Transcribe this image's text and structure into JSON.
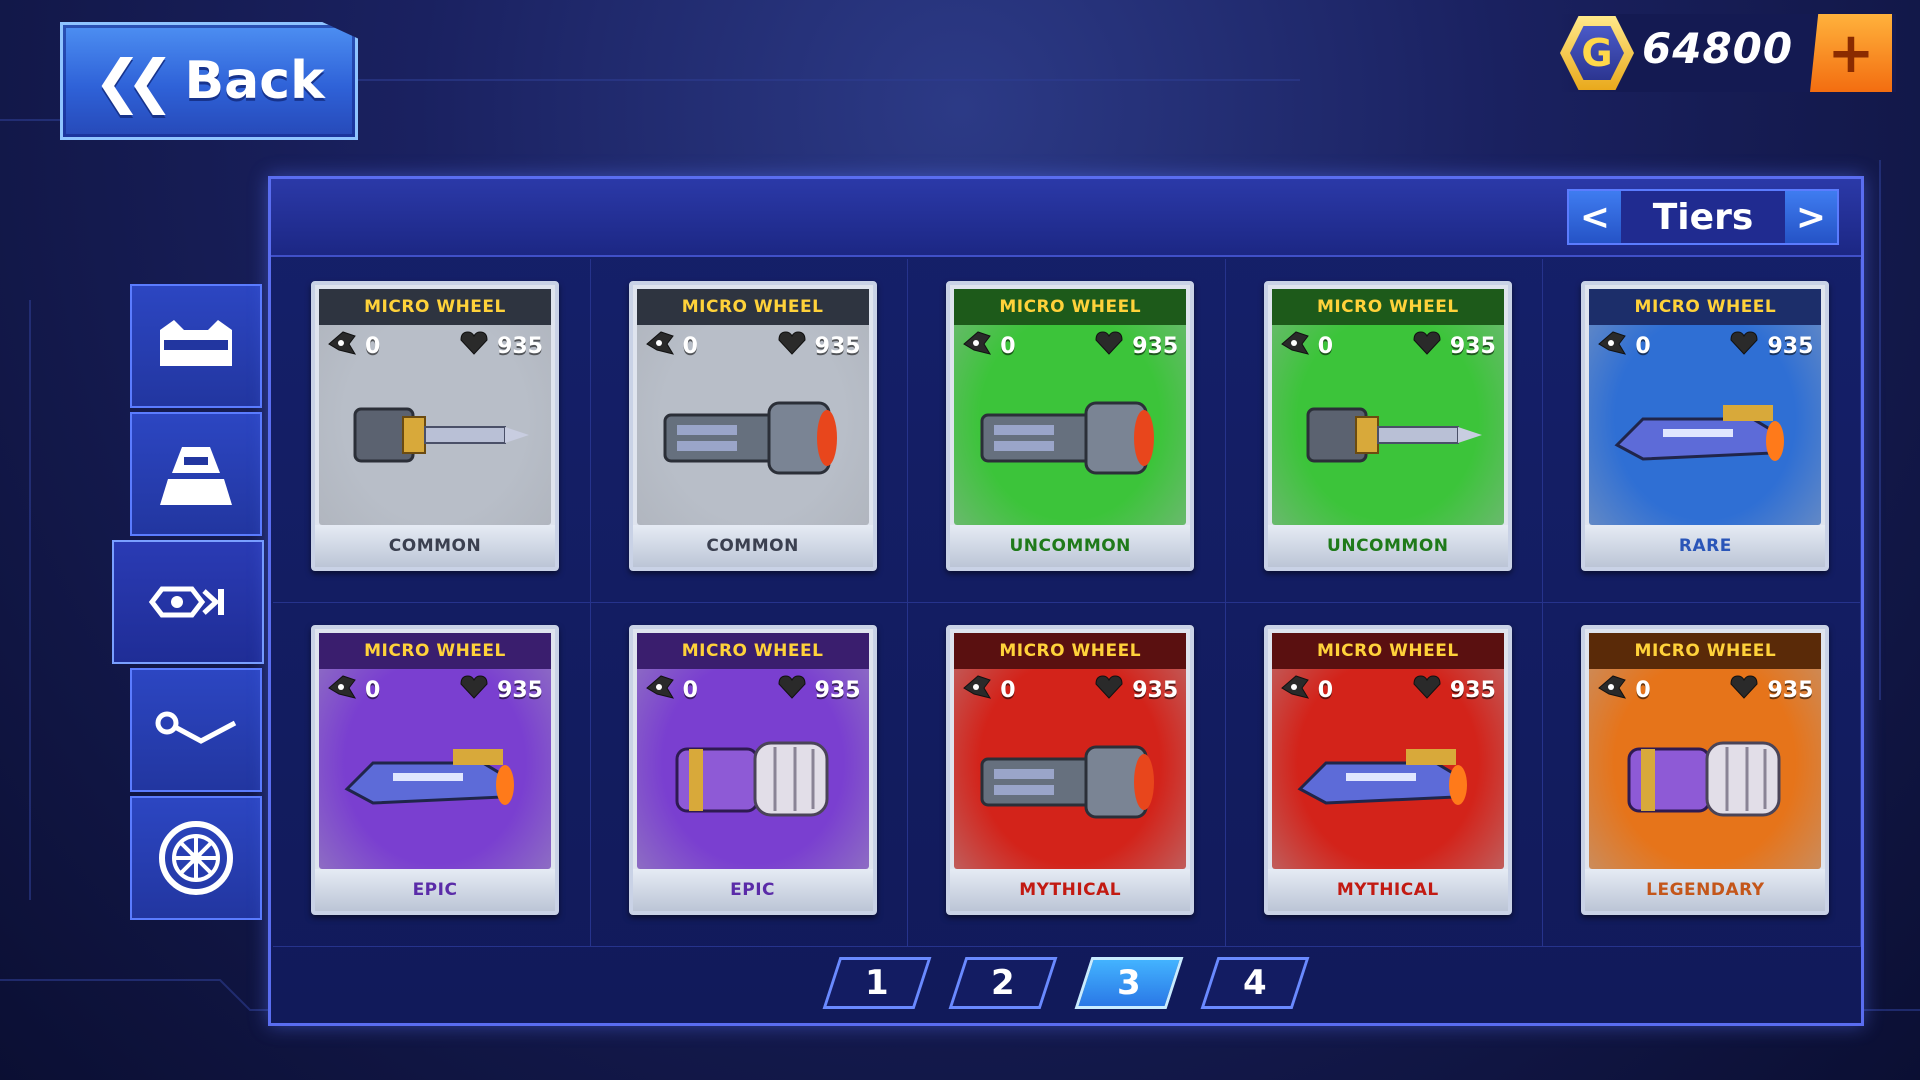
{
  "header": {
    "back_label": "Back",
    "coins": "64800",
    "coin_symbol": "G",
    "add_symbol": "+"
  },
  "tiers": {
    "label": "Tiers",
    "prev_symbol": "<",
    "next_symbol": ">"
  },
  "side_tabs": [
    {
      "icon": "visor-icon"
    },
    {
      "icon": "helmet-icon"
    },
    {
      "icon": "weapon-icon",
      "active": true
    },
    {
      "icon": "wrench-icon"
    },
    {
      "icon": "wheel-icon"
    }
  ],
  "colors": {
    "common": "#b8bec8",
    "uncommon": "#3cc43a",
    "rare": "#2f6fd4",
    "epic": "#7a3fd0",
    "mythical": "#d3231a",
    "legendary": "#e6741a"
  },
  "cards": [
    {
      "title": "MICRO WHEEL",
      "attack": "0",
      "health": "935",
      "rarity": "COMMON",
      "tier": "common",
      "weapon_icon": "drill-gun-icon"
    },
    {
      "title": "MICRO WHEEL",
      "attack": "0",
      "health": "935",
      "rarity": "COMMON",
      "tier": "common",
      "weapon_icon": "cannon-icon"
    },
    {
      "title": "MICRO WHEEL",
      "attack": "0",
      "health": "935",
      "rarity": "UNCOMMON",
      "tier": "uncommon",
      "weapon_icon": "cannon-icon"
    },
    {
      "title": "MICRO WHEEL",
      "attack": "0",
      "health": "935",
      "rarity": "UNCOMMON",
      "tier": "uncommon",
      "weapon_icon": "drill-gun-icon"
    },
    {
      "title": "MICRO WHEEL",
      "attack": "0",
      "health": "935",
      "rarity": "RARE",
      "tier": "rare",
      "weapon_icon": "blaster-icon"
    },
    {
      "title": "MICRO WHEEL",
      "attack": "0",
      "health": "935",
      "rarity": "EPIC",
      "tier": "epic",
      "weapon_icon": "blaster-icon"
    },
    {
      "title": "MICRO WHEEL",
      "attack": "0",
      "health": "935",
      "rarity": "EPIC",
      "tier": "epic",
      "weapon_icon": "fist-icon"
    },
    {
      "title": "MICRO WHEEL",
      "attack": "0",
      "health": "935",
      "rarity": "MYTHICAL",
      "tier": "mythical",
      "weapon_icon": "cannon-icon"
    },
    {
      "title": "MICRO WHEEL",
      "attack": "0",
      "health": "935",
      "rarity": "MYTHICAL",
      "tier": "mythical",
      "weapon_icon": "blaster-icon"
    },
    {
      "title": "MICRO WHEEL",
      "attack": "0",
      "health": "935",
      "rarity": "LEGENDARY",
      "tier": "legendary",
      "weapon_icon": "fist-icon"
    }
  ],
  "pagination": {
    "pages": [
      "1",
      "2",
      "3",
      "4"
    ],
    "current": "3"
  }
}
